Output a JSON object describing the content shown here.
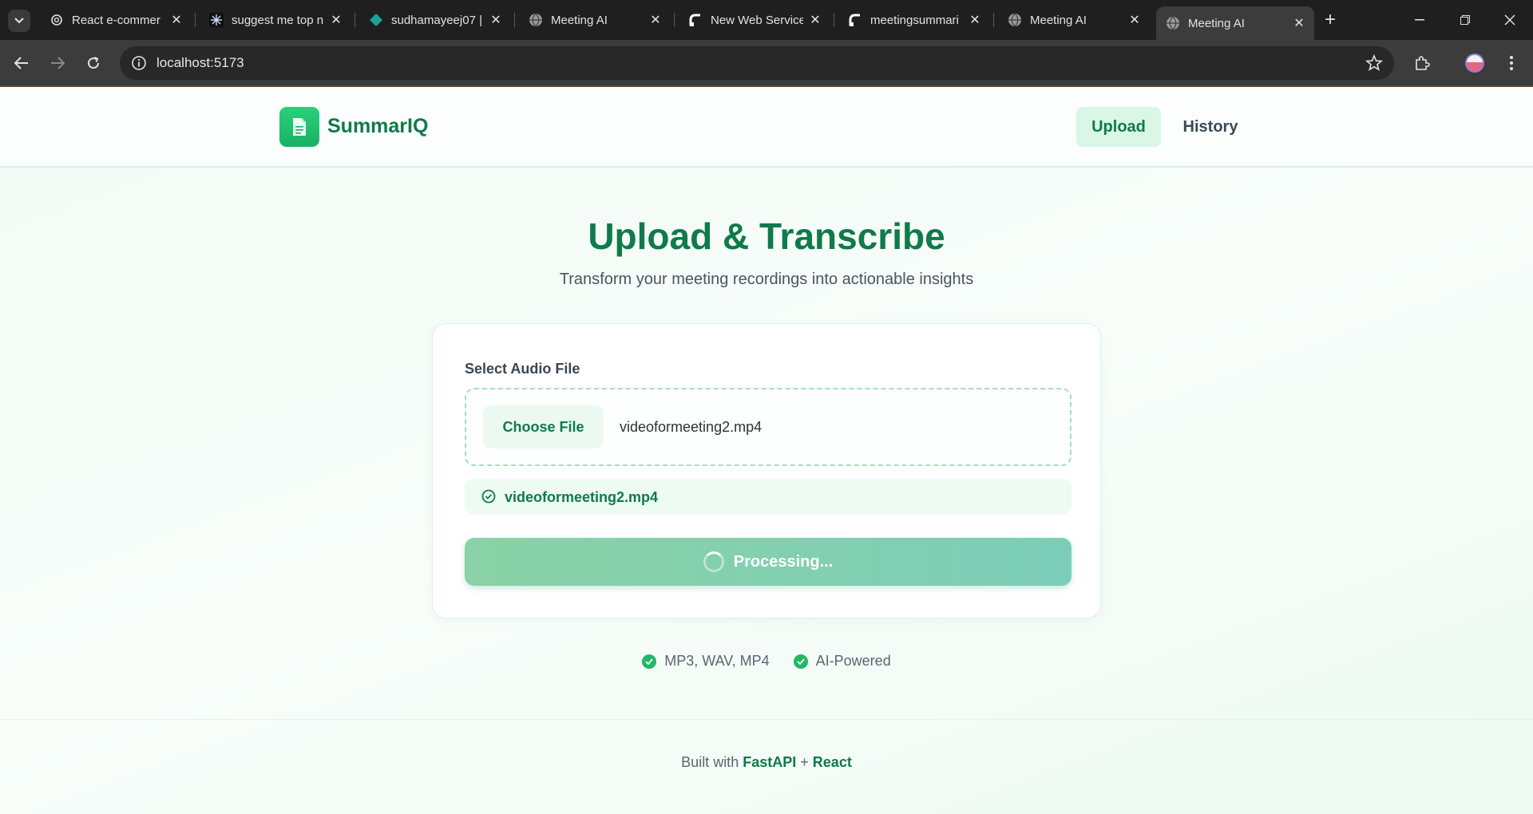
{
  "browser": {
    "tabs": [
      {
        "title": "React e-commer",
        "icon": "openai-icon"
      },
      {
        "title": "suggest me top n",
        "icon": "gear-spark-icon"
      },
      {
        "title": "sudhamayeej07 |",
        "icon": "diamond-icon"
      },
      {
        "title": "Meeting AI",
        "icon": "globe-icon"
      },
      {
        "title": "New Web Service",
        "icon": "render-icon"
      },
      {
        "title": "meetingsummari",
        "icon": "render-icon"
      },
      {
        "title": "Meeting AI",
        "icon": "globe-icon"
      },
      {
        "title": "Meeting AI",
        "icon": "globe-icon",
        "active": true
      }
    ],
    "url": "localhost:5173"
  },
  "app": {
    "brand": "SummarIQ",
    "nav": {
      "upload": "Upload",
      "history": "History"
    },
    "accent": "#0f7a4a"
  },
  "hero": {
    "title": "Upload & Transcribe",
    "subtitle": "Transform your meeting recordings into actionable insights"
  },
  "upload": {
    "label": "Select Audio File",
    "choose_button": "Choose File",
    "file_name": "videoformeeting2.mp4",
    "selected_file": "videoformeeting2.mp4",
    "process_button": "Processing..."
  },
  "features": [
    "MP3, WAV, MP4",
    "AI-Powered"
  ],
  "footer": {
    "prefix": "Built with",
    "tech1": "FastAPI",
    "joiner": "+",
    "tech2": "React"
  }
}
